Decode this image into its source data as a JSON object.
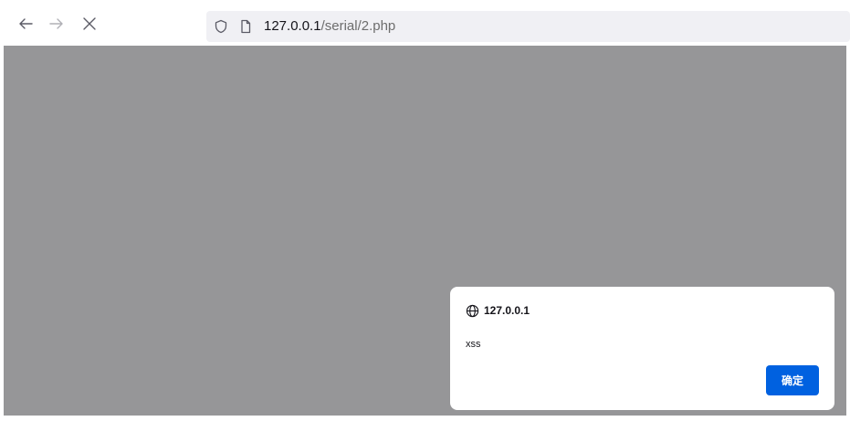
{
  "toolbar": {
    "back": {
      "icon": "arrow-left-icon"
    },
    "forward": {
      "icon": "arrow-right-icon"
    },
    "stop": {
      "icon": "close-icon"
    }
  },
  "urlbar": {
    "shield_icon": "shield-icon",
    "page_icon": "page-icon",
    "host": "127.0.0.1",
    "path": "/serial/2.php"
  },
  "dialog": {
    "origin_icon": "globe-icon",
    "origin": "127.0.0.1",
    "message": "xss",
    "ok_label": "确定"
  },
  "colors": {
    "overlay": "#969698",
    "accent": "#0061e0",
    "urlbar_bg": "#f0f0f4"
  }
}
